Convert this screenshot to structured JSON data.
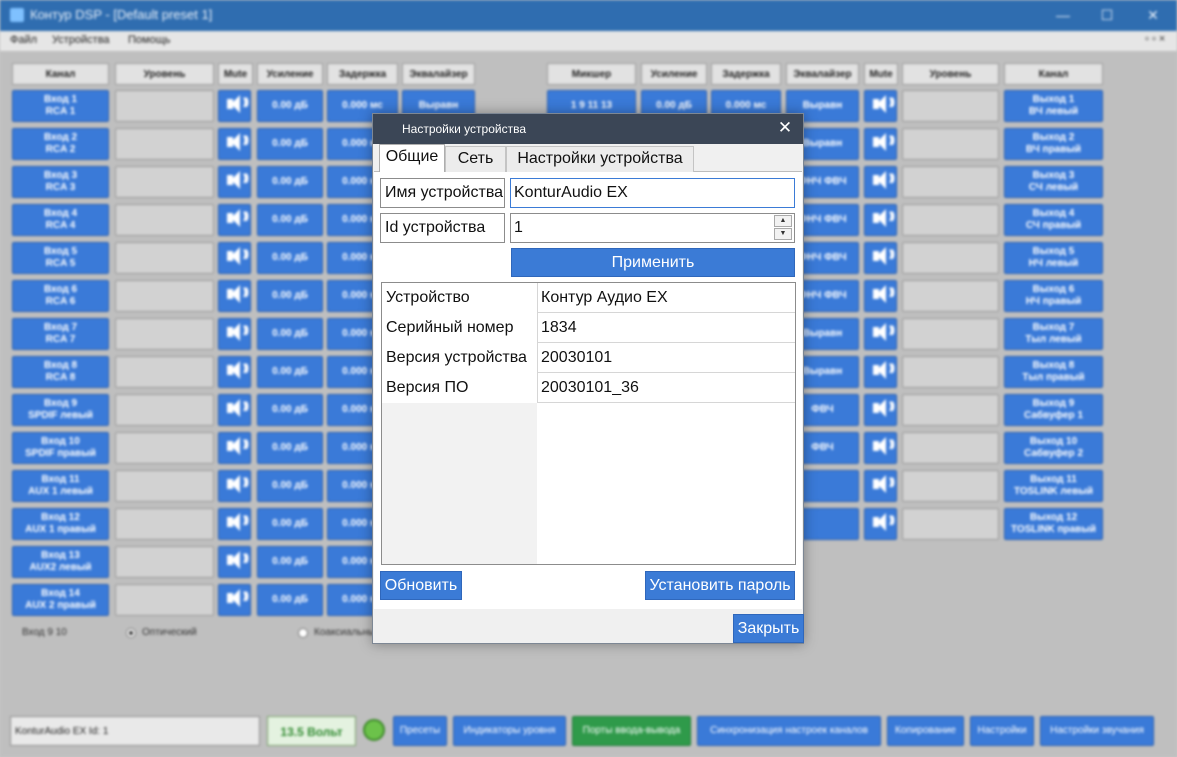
{
  "app": {
    "title": "Контур DSP - [Default preset 1]",
    "menu": [
      "Файл",
      "Устройства",
      "Помощь"
    ],
    "input_headers": [
      "Канал",
      "Уровень",
      "Mute",
      "Усиление",
      "Задержка",
      "Эквалайзер"
    ],
    "output_headers": [
      "Микшер",
      "Усиление",
      "Задержка",
      "Эквалайзер",
      "Mute",
      "Уровень",
      "Канал"
    ],
    "inputs": [
      {
        "l1": "Вход 1",
        "l2": "RCA 1"
      },
      {
        "l1": "Вход 2",
        "l2": "RCA 2"
      },
      {
        "l1": "Вход 3",
        "l2": "RCA 3"
      },
      {
        "l1": "Вход 4",
        "l2": "RCA 4"
      },
      {
        "l1": "Вход 5",
        "l2": "RCA 5"
      },
      {
        "l1": "Вход 6",
        "l2": "RCA 6"
      },
      {
        "l1": "Вход 7",
        "l2": "RCA 7"
      },
      {
        "l1": "Вход 8",
        "l2": "RCA 8"
      },
      {
        "l1": "Вход 9",
        "l2": "SPDIF левый"
      },
      {
        "l1": "Вход 10",
        "l2": "SPDIF правый"
      },
      {
        "l1": "Вход 11",
        "l2": "AUX 1 левый"
      },
      {
        "l1": "Вход 12",
        "l2": "AUX 1 правый"
      },
      {
        "l1": "Вход 13",
        "l2": "AUX2 левый"
      },
      {
        "l1": "Вход 14",
        "l2": "AUX 2 правый"
      }
    ],
    "gain_value": "0.00 дБ",
    "delay_value": "0.000 мс",
    "eq_value": "Выравн",
    "outputs": [
      {
        "l1": "Выход 1",
        "l2": "ВЧ левый"
      },
      {
        "l1": "Выход 2",
        "l2": "ВЧ правый"
      },
      {
        "l1": "Выход 3",
        "l2": "СЧ левый"
      },
      {
        "l1": "Выход 4",
        "l2": "СЧ правый"
      },
      {
        "l1": "Выход 5",
        "l2": "НЧ левый"
      },
      {
        "l1": "Выход 6",
        "l2": "НЧ правый"
      },
      {
        "l1": "Выход 7",
        "l2": "Тыл левый"
      },
      {
        "l1": "Выход 8",
        "l2": "Тыл правый"
      },
      {
        "l1": "Выход 9",
        "l2": "Сабвуфер 1"
      },
      {
        "l1": "Выход 10",
        "l2": "Сабвуфер 2"
      },
      {
        "l1": "Выход 11",
        "l2": "TOSLINK левый"
      },
      {
        "l1": "Выход 12",
        "l2": "TOSLINK правый"
      }
    ],
    "mixer_first": "1 9 11 13",
    "out_eq": [
      "Выравн",
      "Выравн",
      "ФНЧ ФВЧ",
      "ФНЧ ФВЧ",
      "ФНЧ ФВЧ",
      "ФНЧ ФВЧ",
      "Выравн",
      "Выравн",
      "ФВЧ",
      "ФВЧ",
      "",
      ""
    ],
    "input_select": {
      "label": "Вход 9 10",
      "opt1": "Оптический",
      "opt2": "Коаксиальный"
    },
    "status": {
      "device": "KonturAudio EX Id: 1",
      "voltage": "13.5 Вольт"
    },
    "bottom_buttons": [
      "Пресеты",
      "Индикаторы уровня",
      "Порты ввода-вывода",
      "Синхронизация настроек каналов",
      "Копирование",
      "Настройки",
      "Настройки звучания"
    ]
  },
  "dialog": {
    "title": "Настройки устройства",
    "tabs": [
      "Общие",
      "Сеть",
      "Настройки устройства"
    ],
    "name_label": "Имя устройства",
    "name_value": "KonturAudio EX",
    "id_label": "Id устройства",
    "id_value": "1",
    "apply": "Применить",
    "info": [
      {
        "k": "Устройство",
        "v": "Контур Аудио EX"
      },
      {
        "k": "Серийный номер",
        "v": "1834"
      },
      {
        "k": "Версия устройства",
        "v": "20030101"
      },
      {
        "k": "Версия ПО",
        "v": "20030101_36"
      }
    ],
    "refresh": "Обновить",
    "set_password": "Установить пароль",
    "close": "Закрыть"
  }
}
